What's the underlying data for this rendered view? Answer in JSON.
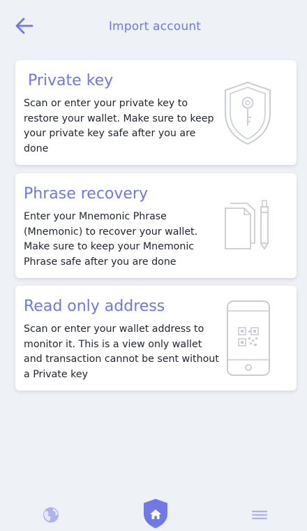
{
  "header": {
    "title": "Import account",
    "back_icon": "arrow-left-icon"
  },
  "cards": [
    {
      "title": "Private key",
      "description": "Scan or enter your private key to restore your wallet. Make sure to keep your private key safe after you are done",
      "icon": "shield-key-icon"
    },
    {
      "title": "Phrase recovery",
      "description": "Enter your Mnemonic Phrase (Mnemonic) to recover your wallet. Make sure to keep your Mnemonic Phrase safe after you are done",
      "icon": "documents-pen-icon"
    },
    {
      "title": "Read only address",
      "description": "Scan or enter your wallet address to monitor it. This is a view only wallet and transaction cannot be sent without a Private key",
      "icon": "phone-qr-icon"
    }
  ],
  "bottom_nav": {
    "items": [
      "globe-icon",
      "home-shield-icon",
      "menu-icon"
    ],
    "active": "home-shield-icon"
  },
  "colors": {
    "accent": "#6e78e8",
    "background": "#eef1f6",
    "card": "#ffffff",
    "text": "#222634",
    "icon_muted": "#c9ccd4"
  }
}
